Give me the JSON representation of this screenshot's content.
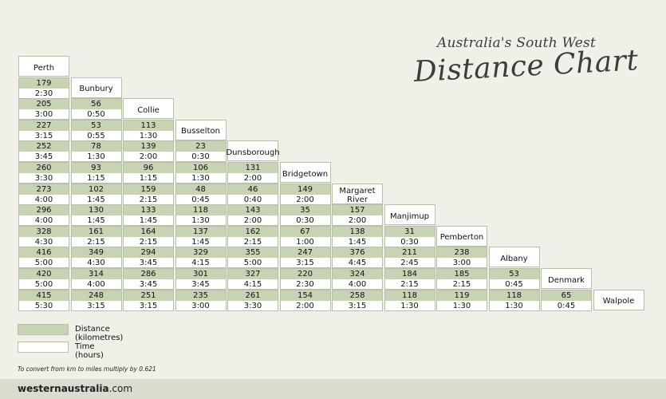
{
  "heading": {
    "subtitle": "Australia's South West",
    "title": "Distance Chart"
  },
  "towns": [
    "Perth",
    "Bunbury",
    "Collie",
    "Busselton",
    "Dunsborough",
    "Bridgetown",
    "Margaret River",
    "Manjimup",
    "Pemberton",
    "Albany",
    "Denmark",
    "Walpole"
  ],
  "rows": [
    [
      [
        "179",
        "2:30"
      ]
    ],
    [
      [
        "205",
        "3:00"
      ],
      [
        "56",
        "0:50"
      ]
    ],
    [
      [
        "227",
        "3:15"
      ],
      [
        "53",
        "0:55"
      ],
      [
        "113",
        "1:30"
      ]
    ],
    [
      [
        "252",
        "3:45"
      ],
      [
        "78",
        "1:30"
      ],
      [
        "139",
        "2:00"
      ],
      [
        "23",
        "0:30"
      ]
    ],
    [
      [
        "260",
        "3:30"
      ],
      [
        "93",
        "1:15"
      ],
      [
        "96",
        "1:15"
      ],
      [
        "106",
        "1:30"
      ],
      [
        "131",
        "2:00"
      ]
    ],
    [
      [
        "273",
        "4:00"
      ],
      [
        "102",
        "1:45"
      ],
      [
        "159",
        "2:15"
      ],
      [
        "48",
        "0:45"
      ],
      [
        "46",
        "0:40"
      ],
      [
        "149",
        "2:00"
      ]
    ],
    [
      [
        "296",
        "4:00"
      ],
      [
        "130",
        "1:45"
      ],
      [
        "133",
        "1:45"
      ],
      [
        "118",
        "1:30"
      ],
      [
        "143",
        "2:00"
      ],
      [
        "35",
        "0:30"
      ],
      [
        "157",
        "2:00"
      ]
    ],
    [
      [
        "328",
        "4:30"
      ],
      [
        "161",
        "2:15"
      ],
      [
        "164",
        "2:15"
      ],
      [
        "137",
        "1:45"
      ],
      [
        "162",
        "2:15"
      ],
      [
        "67",
        "1:00"
      ],
      [
        "138",
        "1:45"
      ],
      [
        "31",
        "0:30"
      ]
    ],
    [
      [
        "416",
        "5:00"
      ],
      [
        "349",
        "4:30"
      ],
      [
        "294",
        "3:45"
      ],
      [
        "329",
        "4:15"
      ],
      [
        "355",
        "5:00"
      ],
      [
        "247",
        "3:15"
      ],
      [
        "376",
        "4:45"
      ],
      [
        "211",
        "2:45"
      ],
      [
        "238",
        "3:00"
      ]
    ],
    [
      [
        "420",
        "5:00"
      ],
      [
        "314",
        "4:00"
      ],
      [
        "286",
        "3:45"
      ],
      [
        "301",
        "3:45"
      ],
      [
        "327",
        "4:15"
      ],
      [
        "220",
        "2:30"
      ],
      [
        "324",
        "4:00"
      ],
      [
        "184",
        "2:15"
      ],
      [
        "185",
        "2:15"
      ],
      [
        "53",
        "0:45"
      ]
    ],
    [
      [
        "415",
        "5:30"
      ],
      [
        "248",
        "3:15"
      ],
      [
        "251",
        "3:15"
      ],
      [
        "235",
        "3:00"
      ],
      [
        "261",
        "3:30"
      ],
      [
        "154",
        "2:00"
      ],
      [
        "258",
        "3:15"
      ],
      [
        "118",
        "1:30"
      ],
      [
        "119",
        "1:30"
      ],
      [
        "118",
        "1:30"
      ],
      [
        "65",
        "0:45"
      ]
    ]
  ],
  "legend": {
    "distance_label": "Distance (kilometres)",
    "time_label": "Time (hours)",
    "distance_color": "#c7d4b3",
    "time_color": "#ffffff"
  },
  "note": "To convert from km to miles multiply by 0.621",
  "footer": {
    "site_main": "westernaustralia",
    "site_suffix": ".com"
  }
}
